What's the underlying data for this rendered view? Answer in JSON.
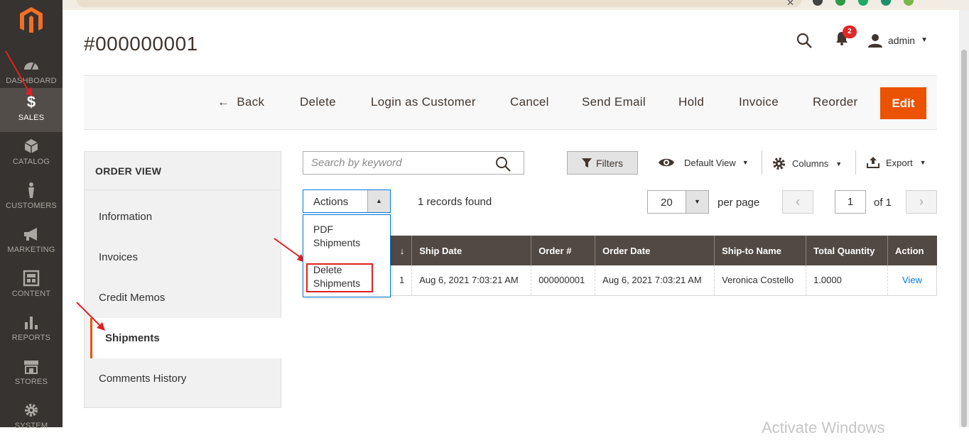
{
  "browser": {
    "close_glyph": "✕"
  },
  "sidebar": {
    "items": [
      {
        "label": "DASHBOARD",
        "icon": "dashboard-icon"
      },
      {
        "label": "SALES",
        "icon": "dollar-icon",
        "active": true
      },
      {
        "label": "CATALOG",
        "icon": "cube-icon"
      },
      {
        "label": "CUSTOMERS",
        "icon": "person-icon"
      },
      {
        "label": "MARKETING",
        "icon": "megaphone-icon"
      },
      {
        "label": "CONTENT",
        "icon": "layout-icon"
      },
      {
        "label": "REPORTS",
        "icon": "bar-chart-icon"
      },
      {
        "label": "STORES",
        "icon": "store-icon"
      },
      {
        "label": "SYSTEM",
        "icon": "gear-icon"
      }
    ]
  },
  "header": {
    "title": "#000000001",
    "notification_count": "2",
    "user": "admin"
  },
  "action_bar": {
    "back": "Back",
    "delete": "Delete",
    "login_as_customer": "Login as Customer",
    "cancel": "Cancel",
    "send_email": "Send Email",
    "hold": "Hold",
    "invoice": "Invoice",
    "reorder": "Reorder",
    "edit": "Edit"
  },
  "order_view": {
    "title": "ORDER VIEW",
    "items": [
      "Information",
      "Invoices",
      "Credit Memos",
      "Shipments",
      "Comments History"
    ],
    "active": "Shipments"
  },
  "grid": {
    "search_placeholder": "Search by keyword",
    "filters": "Filters",
    "default_view": "Default View",
    "columns": "Columns",
    "export": "Export",
    "actions_label": "Actions",
    "actions_options": [
      "PDF Shipments",
      "Delete Shipments"
    ],
    "records_found": "1 records found",
    "per_page_value": "20",
    "per_page_label": "per page",
    "page_current": "1",
    "page_of": "of 1",
    "sort_indicator": "↓",
    "columns_headers": [
      "Ship Date",
      "Order #",
      "Order Date",
      "Ship-to Name",
      "Total Quantity",
      "Action"
    ],
    "first_col_partial": "1",
    "rows": [
      {
        "ship_date": "Aug 6, 2021 7:03:21 AM",
        "order": "000000001",
        "order_date": "Aug 6, 2021 7:03:21 AM",
        "ship_to": "Veronica Costello",
        "qty": "1.0000",
        "action": "View"
      }
    ]
  },
  "watermark": "Activate Windows",
  "colors": {
    "accent": "#eb5202",
    "sidebar": "#373330",
    "table_header": "#514943",
    "link": "#007bdb",
    "annotation": "#e02020"
  }
}
